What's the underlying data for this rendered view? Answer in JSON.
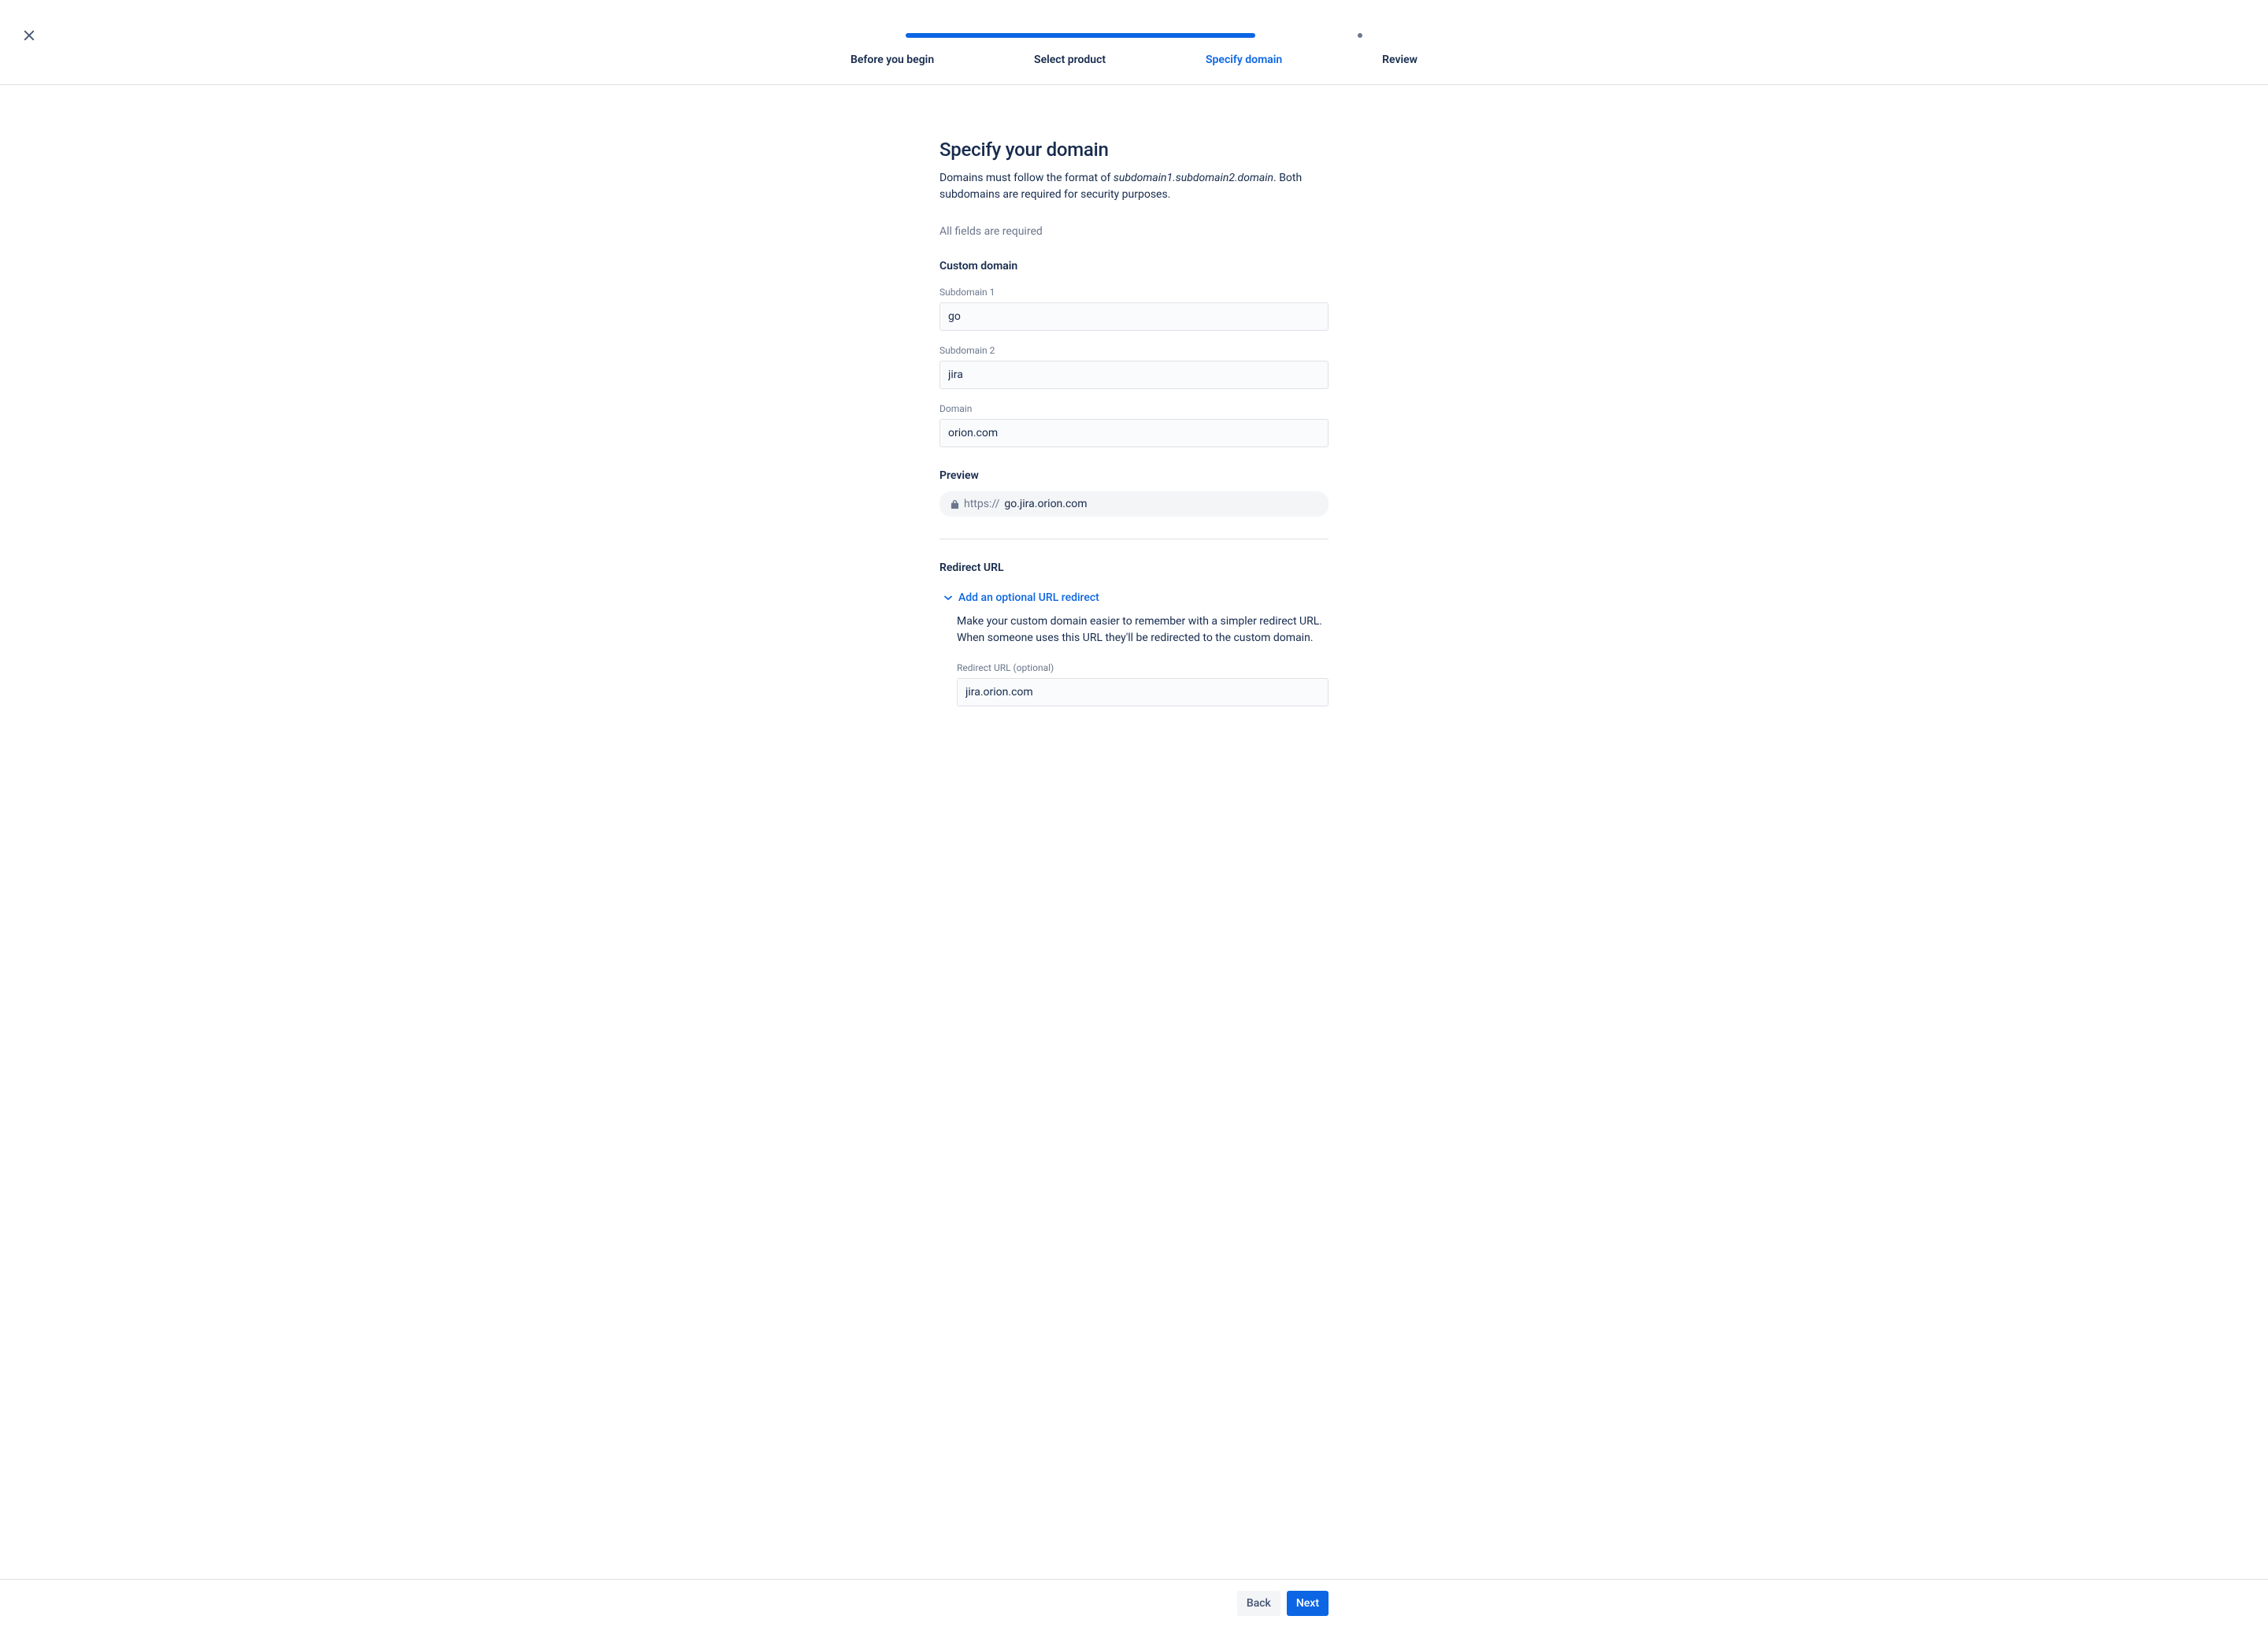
{
  "stepper": {
    "steps": [
      {
        "label": "Before you begin",
        "state": "done"
      },
      {
        "label": "Select product",
        "state": "done"
      },
      {
        "label": "Specify domain",
        "state": "active"
      },
      {
        "label": "Review",
        "state": "upcoming"
      }
    ]
  },
  "page": {
    "title": "Specify your domain",
    "desc_prefix": "Domains must follow the format of ",
    "desc_format": "subdomain1.subdomain2.domain",
    "desc_suffix": ". Both subdomains are required for security purposes.",
    "required_hint": "All fields are required"
  },
  "customDomain": {
    "section_title": "Custom domain",
    "sub1_label": "Subdomain 1",
    "sub1_value": "go",
    "sub2_label": "Subdomain 2",
    "sub2_value": "jira",
    "domain_label": "Domain",
    "domain_value": "orion.com"
  },
  "preview": {
    "title": "Preview",
    "scheme": "https://",
    "domain": "go.jira.orion.com"
  },
  "redirect": {
    "section_title": "Redirect URL",
    "expand_label": "Add an optional URL redirect",
    "description": "Make your custom domain easier to remember with a simpler redirect URL. When someone uses this URL they'll be redirected to the custom domain.",
    "field_label": "Redirect URL (optional)",
    "value": "jira.orion.com"
  },
  "footer": {
    "back": "Back",
    "next": "Next"
  }
}
